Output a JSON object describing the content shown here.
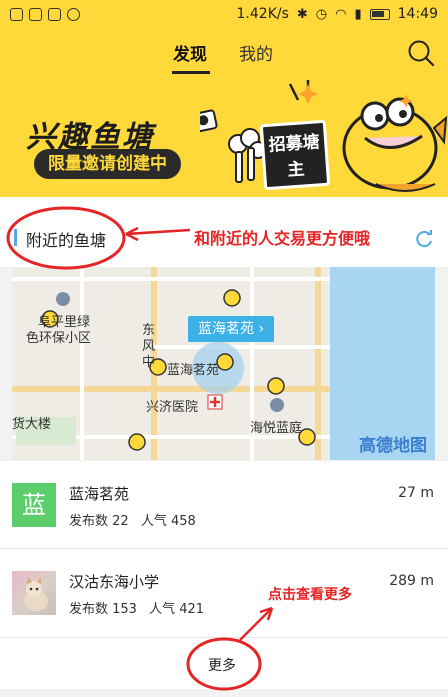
{
  "status": {
    "speed": "1.42K/s",
    "time": "14:49"
  },
  "tabs": {
    "found": "发现",
    "mine": "我的"
  },
  "banner": {
    "title": "兴趣鱼塘",
    "subtitle": "限量邀请创建中",
    "sign": "招募塘主"
  },
  "nearby": {
    "title": "附近的鱼塘"
  },
  "annotations": {
    "top": "和附近的人交易更方便哦",
    "bottom": "点击查看更多"
  },
  "map": {
    "callout": "蓝海茗苑 ›",
    "labels": [
      "阜平里绿",
      "色环保小区",
      "东",
      "风",
      "中",
      "蓝海茗苑",
      "兴济医院",
      "货大楼",
      "海悦蓝庭"
    ],
    "provider": "高德地图"
  },
  "ponds": [
    {
      "thumb_text": "蓝",
      "name": "蓝海茗苑",
      "posts_label": "发布数 22",
      "popularity_label": "人气 458",
      "distance": "27 m"
    },
    {
      "thumb_text": "",
      "name": "汉沽东海小学",
      "posts_label": "发布数 153",
      "popularity_label": "人气 421",
      "distance": "289 m"
    }
  ],
  "more": "更多",
  "colors": {
    "accent_yellow": "#ffd83a",
    "annotation_red": "#e52525",
    "map_blue": "#3bb1e8",
    "green": "#5ccd6b"
  }
}
